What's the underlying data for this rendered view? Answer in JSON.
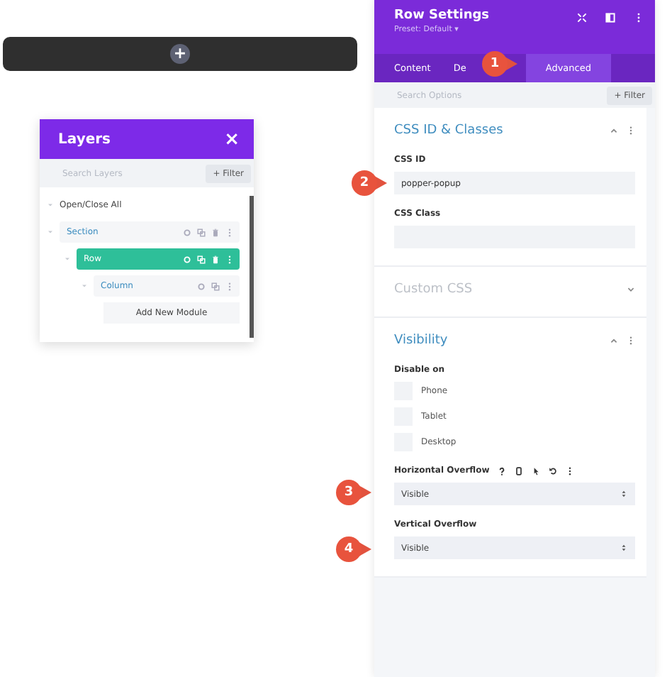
{
  "canvas_bar": {
    "add_button": "+"
  },
  "layers": {
    "title": "Layers",
    "close": "×",
    "search": {
      "placeholder": "Search Layers"
    },
    "filter": "+ Filter",
    "toggle_all": "Open/Close All",
    "tree": [
      {
        "label": "Section",
        "selected": false,
        "children": [
          {
            "label": "Row",
            "selected": true,
            "children": [
              {
                "label": "Column",
                "selected": false
              }
            ]
          }
        ]
      }
    ],
    "add_module": "Add New Module"
  },
  "settings": {
    "title": "Row Settings",
    "preset": "Preset: Default ▾",
    "tabs": [
      {
        "label": "Content",
        "selected": false
      },
      {
        "label": "De",
        "selected": false
      },
      {
        "label": "Advanced",
        "selected": true
      }
    ],
    "search": {
      "placeholder": "Search Options"
    },
    "filter": "+ Filter",
    "sections": [
      {
        "title": "CSS ID & Classes",
        "expanded": true,
        "fields": [
          {
            "kind": "text",
            "label": "CSS ID",
            "value": "popper-popup"
          },
          {
            "kind": "text",
            "label": "CSS Class"
          }
        ]
      },
      {
        "title": "Custom CSS",
        "expanded": false
      },
      {
        "title": "Visibility",
        "expanded": true,
        "fields": [
          {
            "kind": "checks",
            "label": "Disable on",
            "options": [
              {
                "label": "Phone",
                "checked": false
              },
              {
                "label": "Tablet",
                "checked": false
              },
              {
                "label": "Desktop",
                "checked": false
              }
            ]
          },
          {
            "kind": "select",
            "label": "Horizontal Overflow",
            "value": "Visible",
            "tools": true
          },
          {
            "kind": "select",
            "label": "Vertical Overflow",
            "value": "Visible"
          }
        ]
      }
    ]
  },
  "callouts": [
    {
      "number": "1"
    },
    {
      "number": "2"
    },
    {
      "number": "3"
    },
    {
      "number": "4"
    }
  ]
}
